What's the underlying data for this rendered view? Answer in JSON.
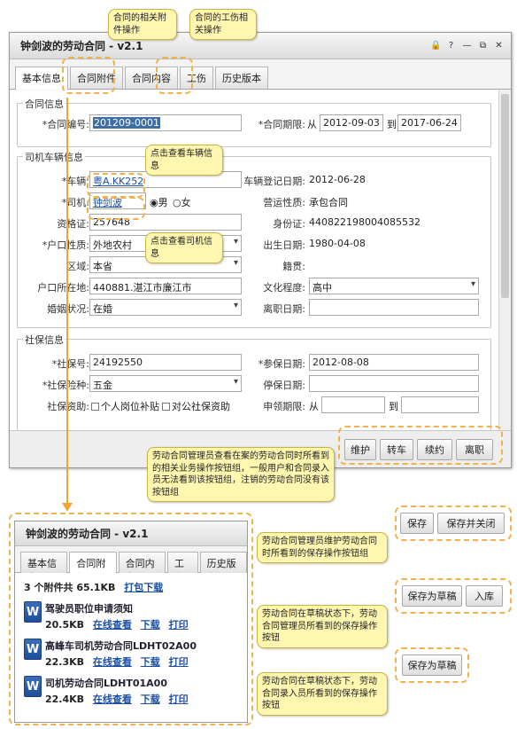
{
  "window": {
    "title": "钟剑波的劳动合同 - v2.1",
    "tabs": [
      "基本信息",
      "合同附件",
      "合同内容",
      "工伤",
      "历史版本"
    ]
  },
  "contract": {
    "section": "合同信息",
    "no_label": "*合同编号:",
    "no_value": "201209-0001",
    "term_label": "*合同期限:",
    "from_label": "从",
    "from_value": "2012-09-03",
    "to_label": "到",
    "to_value": "2017-06-24"
  },
  "driver": {
    "section": "司机车辆信息",
    "vehicle_label": "*车辆:",
    "vehicle_value": "粤A.KK252",
    "reg_date_label": "车辆登记日期:",
    "reg_date_value": "2012-06-28",
    "driver_label": "*司机:",
    "driver_value": "钟剑波",
    "gender_male": "男",
    "gender_female": "女",
    "operation_label": "营运性质:",
    "operation_value": "承包合同",
    "cert_label": "资格证:",
    "cert_value": "257648",
    "id_label": "身份证:",
    "id_value": "440822198004085532",
    "hukou_type_label": "*户口性质:",
    "hukou_type_value": "外地农村",
    "birth_label": "出生日期:",
    "birth_value": "1980-04-08",
    "region_label": "区域:",
    "region_value": "本省",
    "native_label": "籍贯:",
    "hukou_addr_label": "户口所在地:",
    "hukou_addr_value": "440881.湛江市廉江市",
    "education_label": "文化程度:",
    "education_value": "高中",
    "marital_label": "婚姻状况:",
    "marital_value": "在婚",
    "leave_label": "离职日期:"
  },
  "social": {
    "section": "社保信息",
    "no_label": "*社保号:",
    "no_value": "24192550",
    "join_label": "*参保日期:",
    "join_value": "2012-08-08",
    "type_label": "*社保险种:",
    "type_value": "五金",
    "stop_label": "停保日期:",
    "subsidy_label": "社保资助:",
    "subsidy_opt1": "个人岗位补贴",
    "subsidy_opt2": "对公社保资助",
    "claim_label": "申领期限:",
    "claim_from": "从",
    "claim_to": "到"
  },
  "actions": [
    "维护",
    "转车",
    "续约",
    "离职"
  ],
  "side_buttons": {
    "save": "保存",
    "save_close": "保存并关闭",
    "save_draft": "保存为草稿",
    "warehouse": "入库",
    "save_draft2": "保存为草稿"
  },
  "callouts": {
    "attachments": "合同的相关附件操作",
    "injury": "合同的工伤相关操作",
    "vehicle": "点击查看车辆信息",
    "driver": "点击查看司机信息",
    "actions": "劳动合同管理员查看在案的劳动合同时所看到的相关业务操作按钮组，一般用户和合同录入员无法看到该按钮组，注销的劳动合同没有该按钮组",
    "save_admin": "劳动合同管理员维护劳动合同时所看到的保存操作按钮组",
    "save_draft_admin": "劳动合同在草稿状态下，劳动合同管理员所看到的保存操作按钮",
    "save_draft_entry": "劳动合同在草稿状态下，劳动合同录入员所看到的保存操作按钮"
  },
  "attachments_window": {
    "title": "钟剑波的劳动合同 - v2.1",
    "summary": "3 个附件共 65.1KB",
    "pack_download": "打包下载",
    "view": "在线查看",
    "download": "下载",
    "print": "打印",
    "files": [
      {
        "name": "驾驶员职位申请须知",
        "size": "20.5KB"
      },
      {
        "name": "高峰车司机劳动合同LDHT02A00",
        "size": "22.3KB"
      },
      {
        "name": "司机劳动合同LDHT01A00",
        "size": "22.4KB"
      }
    ]
  },
  "colors": {
    "callout_bg": "#fff7b0",
    "dash": "#f2b14a",
    "selection": "#3d6ea8",
    "link": "#1a4fa6"
  }
}
